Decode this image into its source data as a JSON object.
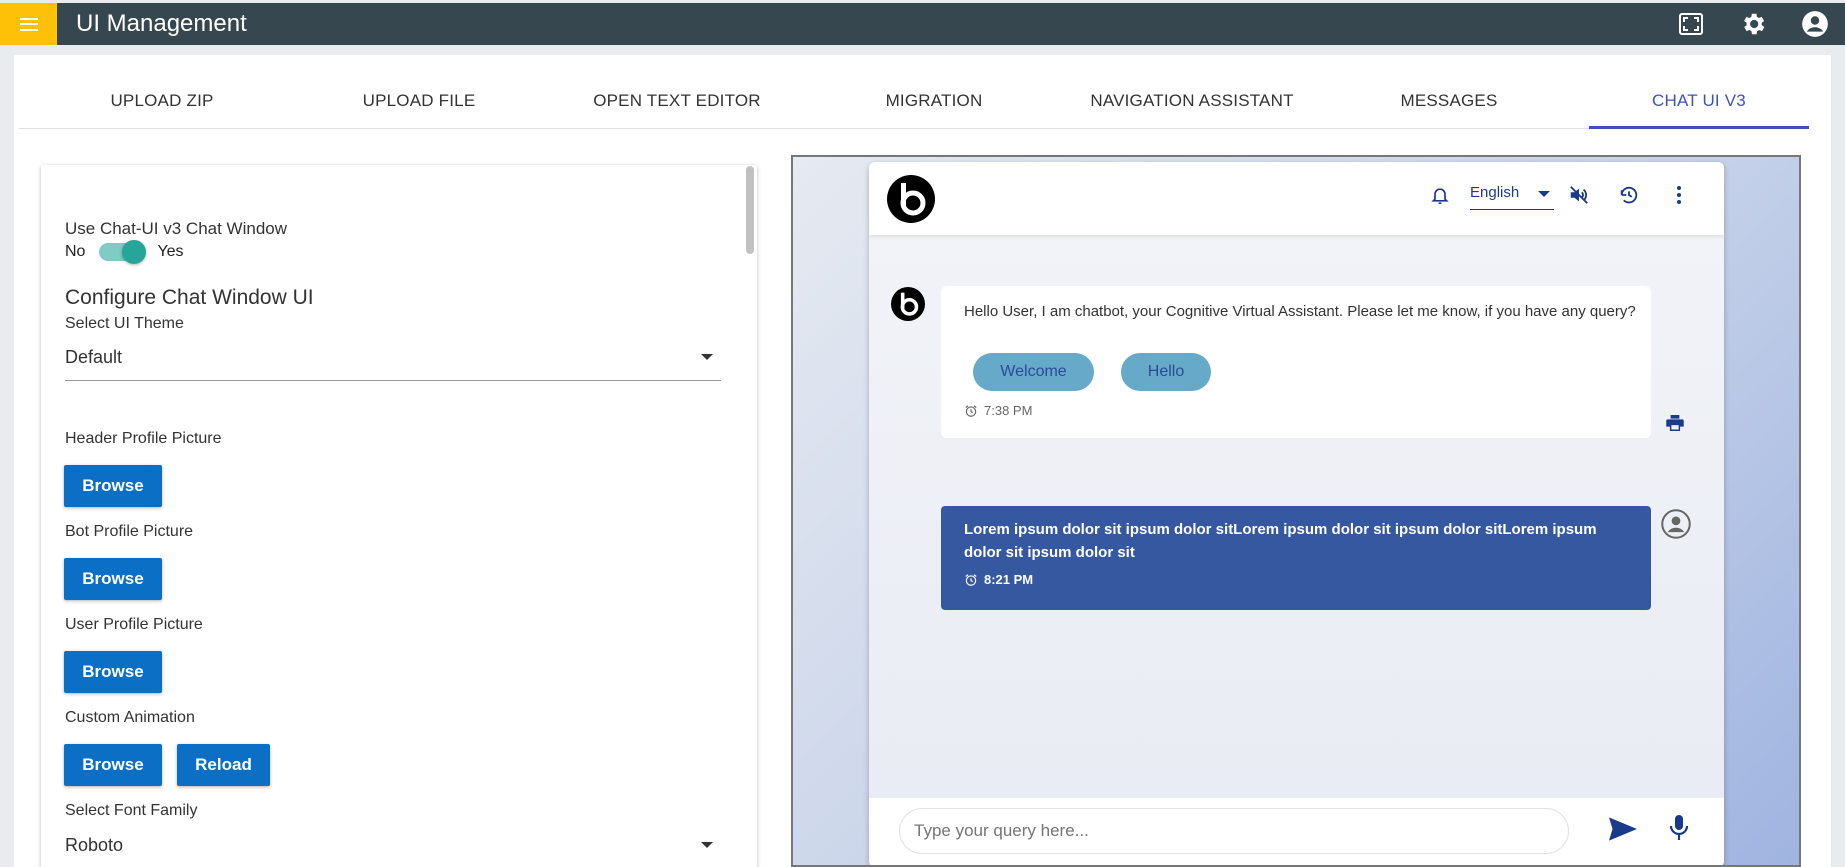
{
  "app": {
    "title": "UI Management"
  },
  "topbar": {
    "icons": [
      "menu-icon",
      "fullscreen-icon",
      "gear-icon",
      "account-icon"
    ]
  },
  "tabs": [
    {
      "label": "UPLOAD ZIP"
    },
    {
      "label": "UPLOAD FILE"
    },
    {
      "label": "OPEN TEXT EDITOR"
    },
    {
      "label": "MIGRATION"
    },
    {
      "label": "NAVIGATION ASSISTANT"
    },
    {
      "label": "MESSAGES"
    },
    {
      "label": "CHAT UI V3",
      "active": true
    }
  ],
  "config": {
    "use_v3_label": "Use Chat-UI v3 Chat Window",
    "toggle_no": "No",
    "toggle_yes": "Yes",
    "toggle_on": true,
    "section_title": "Configure Chat Window UI",
    "theme_label": "Select UI Theme",
    "theme_value": "Default",
    "header_pic_label": "Header Profile Picture",
    "bot_pic_label": "Bot Profile Picture",
    "user_pic_label": "User Profile Picture",
    "animation_label": "Custom Animation",
    "browse_label": "Browse",
    "reload_label": "Reload",
    "font_label": "Select Font Family",
    "font_value": "Roboto"
  },
  "chat": {
    "language": "English",
    "header_icons": [
      "bell-icon",
      "mute-icon",
      "history-icon",
      "more-vert-icon"
    ],
    "bot_message": "Hello User, I am chatbot, your Cognitive Virtual Assistant. Please let me know, if you have any query?",
    "chips": [
      "Welcome",
      "Hello"
    ],
    "bot_time": "7:38 PM",
    "user_message": "Lorem ipsum dolor sit ipsum dolor sitLorem ipsum dolor sit ipsum dolor sitLorem ipsum dolor sit ipsum dolor sit",
    "user_time": "8:21 PM",
    "input_placeholder": "Type your query here..."
  },
  "colors": {
    "topbar": "#37474f",
    "menu_button": "#ffc107",
    "active_tab": "#3f51b5",
    "primary_button": "#0b6fc6",
    "toggle": "#26a69a",
    "user_bubble": "#3558a0",
    "chip": "#66a9c8"
  }
}
